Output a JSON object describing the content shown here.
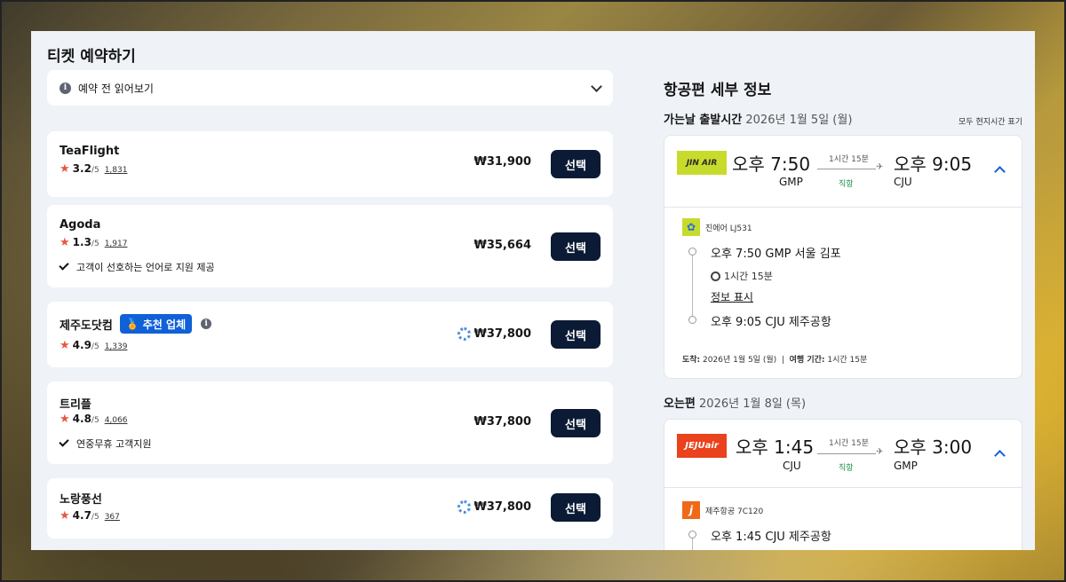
{
  "left": {
    "title": "티켓 예약하기",
    "accordion": {
      "icon": "info-icon",
      "label": "예약 전 읽어보기"
    },
    "providers": [
      {
        "name": "TeaFlight",
        "score": "3.2",
        "out_of": "/5",
        "reviews": "1,831",
        "feature": "",
        "price": "₩31,900",
        "loading": false,
        "recommended": false,
        "button": "선택"
      },
      {
        "name": "Agoda",
        "score": "1.3",
        "out_of": "/5",
        "reviews": "1,917",
        "feature": "고객이 선호하는 언어로 지원 제공",
        "price": "₩35,664",
        "loading": false,
        "recommended": false,
        "button": "선택"
      },
      {
        "name": "제주도닷컴",
        "score": "4.9",
        "out_of": "/5",
        "reviews": "1,339",
        "feature": "",
        "price": "₩37,800",
        "loading": true,
        "recommended": true,
        "badge": "추천 업체",
        "button": "선택"
      },
      {
        "name": "트리플",
        "score": "4.8",
        "out_of": "/5",
        "reviews": "4,066",
        "feature": "연중무휴 고객지원",
        "price": "₩37,800",
        "loading": false,
        "recommended": false,
        "button": "선택"
      },
      {
        "name": "노랑풍선",
        "score": "4.7",
        "out_of": "/5",
        "reviews": "367",
        "feature": "",
        "price": "₩37,800",
        "loading": true,
        "recommended": false,
        "button": "선택"
      }
    ]
  },
  "right": {
    "title": "항공편 세부 정보",
    "tz_note": "모두 현지시간 표기",
    "outbound": {
      "label": "가는날 출발시간",
      "date": "2026년 1월 5일 (월)",
      "airline_logo_text": "JIN AIR",
      "dep_time": "오후 7:50",
      "dep_code": "GMP",
      "arr_time": "오후 9:05",
      "arr_code": "CJU",
      "duration": "1시간 15분",
      "stops": "직항",
      "flight": "진에어 LJ531",
      "dep_detail": "오후 7:50 GMP 서울 김포",
      "leg_duration": "1시간 15분",
      "detail_link": "정보 표시",
      "arr_detail": "오후 9:05 CJU 제주공항",
      "arrival_label": "도착:",
      "arrival_value": "2026년 1월 5일 (월)",
      "travel_label": "여행 기간:",
      "travel_value": "1시간 15분"
    },
    "inbound": {
      "label": "오는편",
      "date": "2026년 1월 8일 (목)",
      "airline_logo_text": "JEJUair",
      "dep_time": "오후 1:45",
      "dep_code": "CJU",
      "arr_time": "오후 3:00",
      "arr_code": "GMP",
      "duration": "1시간 15분",
      "stops": "직항",
      "flight": "제주항공 7C120",
      "dep_detail": "오후 1:45 CJU 제주공항"
    }
  },
  "colors": {
    "accent": "#1060d8",
    "button": "#0b1b35",
    "star": "#e5573f",
    "panel": "#eff3f8"
  }
}
